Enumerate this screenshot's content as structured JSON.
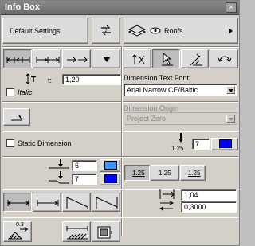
{
  "window": {
    "title": "Info Box",
    "close_label": "×"
  },
  "toolbar": {
    "default_settings_label": "Default Settings",
    "layer_label": "Roofs"
  },
  "dimension": {
    "text_height_value": "1,20",
    "text_height_label": "t:",
    "italic_label": "Italic",
    "font_label": "Dimension Text Font:",
    "font_value": "Arial Narrow CE/Baltic",
    "origin_label": "Dimension Origin",
    "origin_value": "Project Zero",
    "static_label": "Static Dimension",
    "pen_size_label": "1.25",
    "pen_value": "7",
    "pen_color": "#0000ff"
  },
  "pens": {
    "marker_pen_value": "6",
    "marker_pen_color": "#3399ff",
    "line_pen_value": "7",
    "line_pen_color": "#0000ff"
  },
  "marker_sizes": {
    "a": "1.25",
    "b": "1.25",
    "c": "1.25"
  },
  "extension": {
    "value1": "1,04",
    "value2": "0,3000"
  },
  "bottom": {
    "scale_label": "0.3"
  },
  "icons": [
    "arrows-exchange-icon",
    "layer-stack-icon",
    "eye-icon",
    "dropdown-arrow-icon",
    "dimension-type-icon",
    "text-height-icon",
    "pen-icon",
    "witness-line-icon"
  ]
}
